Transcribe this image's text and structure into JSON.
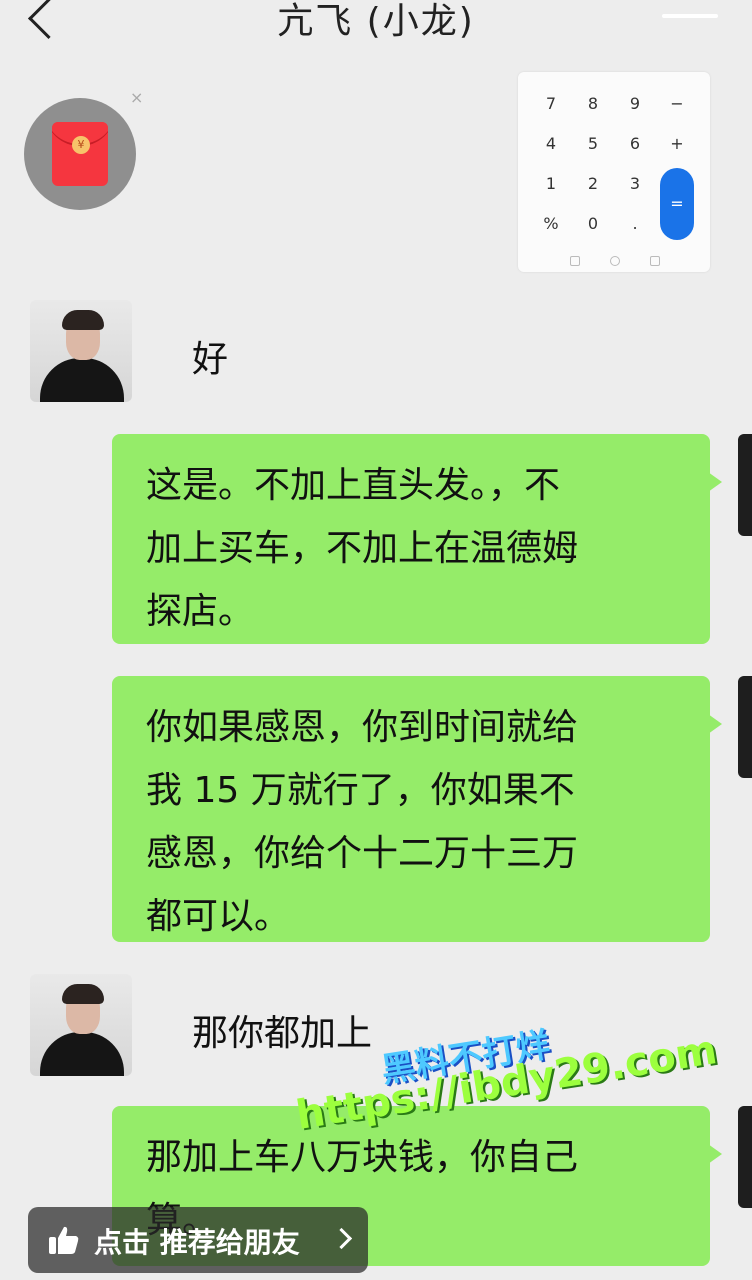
{
  "header": {
    "title": "亢飞 (小龙)"
  },
  "red_packet": {
    "coin_symbol": "¥",
    "close_symbol": "×"
  },
  "calculator": {
    "rows": [
      [
        "7",
        "8",
        "9",
        "−"
      ],
      [
        "4",
        "5",
        "6",
        "+"
      ],
      [
        "1",
        "2",
        "3"
      ],
      [
        "%",
        "0",
        "."
      ]
    ],
    "equals": "="
  },
  "messages": [
    {
      "side": "left",
      "text": "好"
    },
    {
      "side": "right",
      "lines": [
        "这是。不加上直头发。，不",
        "加上买车，不加上在温德姆",
        "探店。"
      ]
    },
    {
      "side": "right",
      "lines": [
        "你如果感恩，你到时间就给",
        "我 15 万就行了，你如果不",
        "感恩，你给个十二万十三万",
        "都可以。"
      ]
    },
    {
      "side": "left",
      "text": "那你都加上"
    },
    {
      "side": "right",
      "lines": [
        "那加上车八万块钱，你自己",
        "算。"
      ]
    }
  ],
  "watermark": {
    "line1": "黑料不打烊",
    "line2": "https://ibdy29.com"
  },
  "recommend": {
    "label": "点击 推荐给朋友"
  },
  "colors": {
    "bubble": "#95ec69",
    "background": "#ededed",
    "accent": "#1a73e8"
  }
}
